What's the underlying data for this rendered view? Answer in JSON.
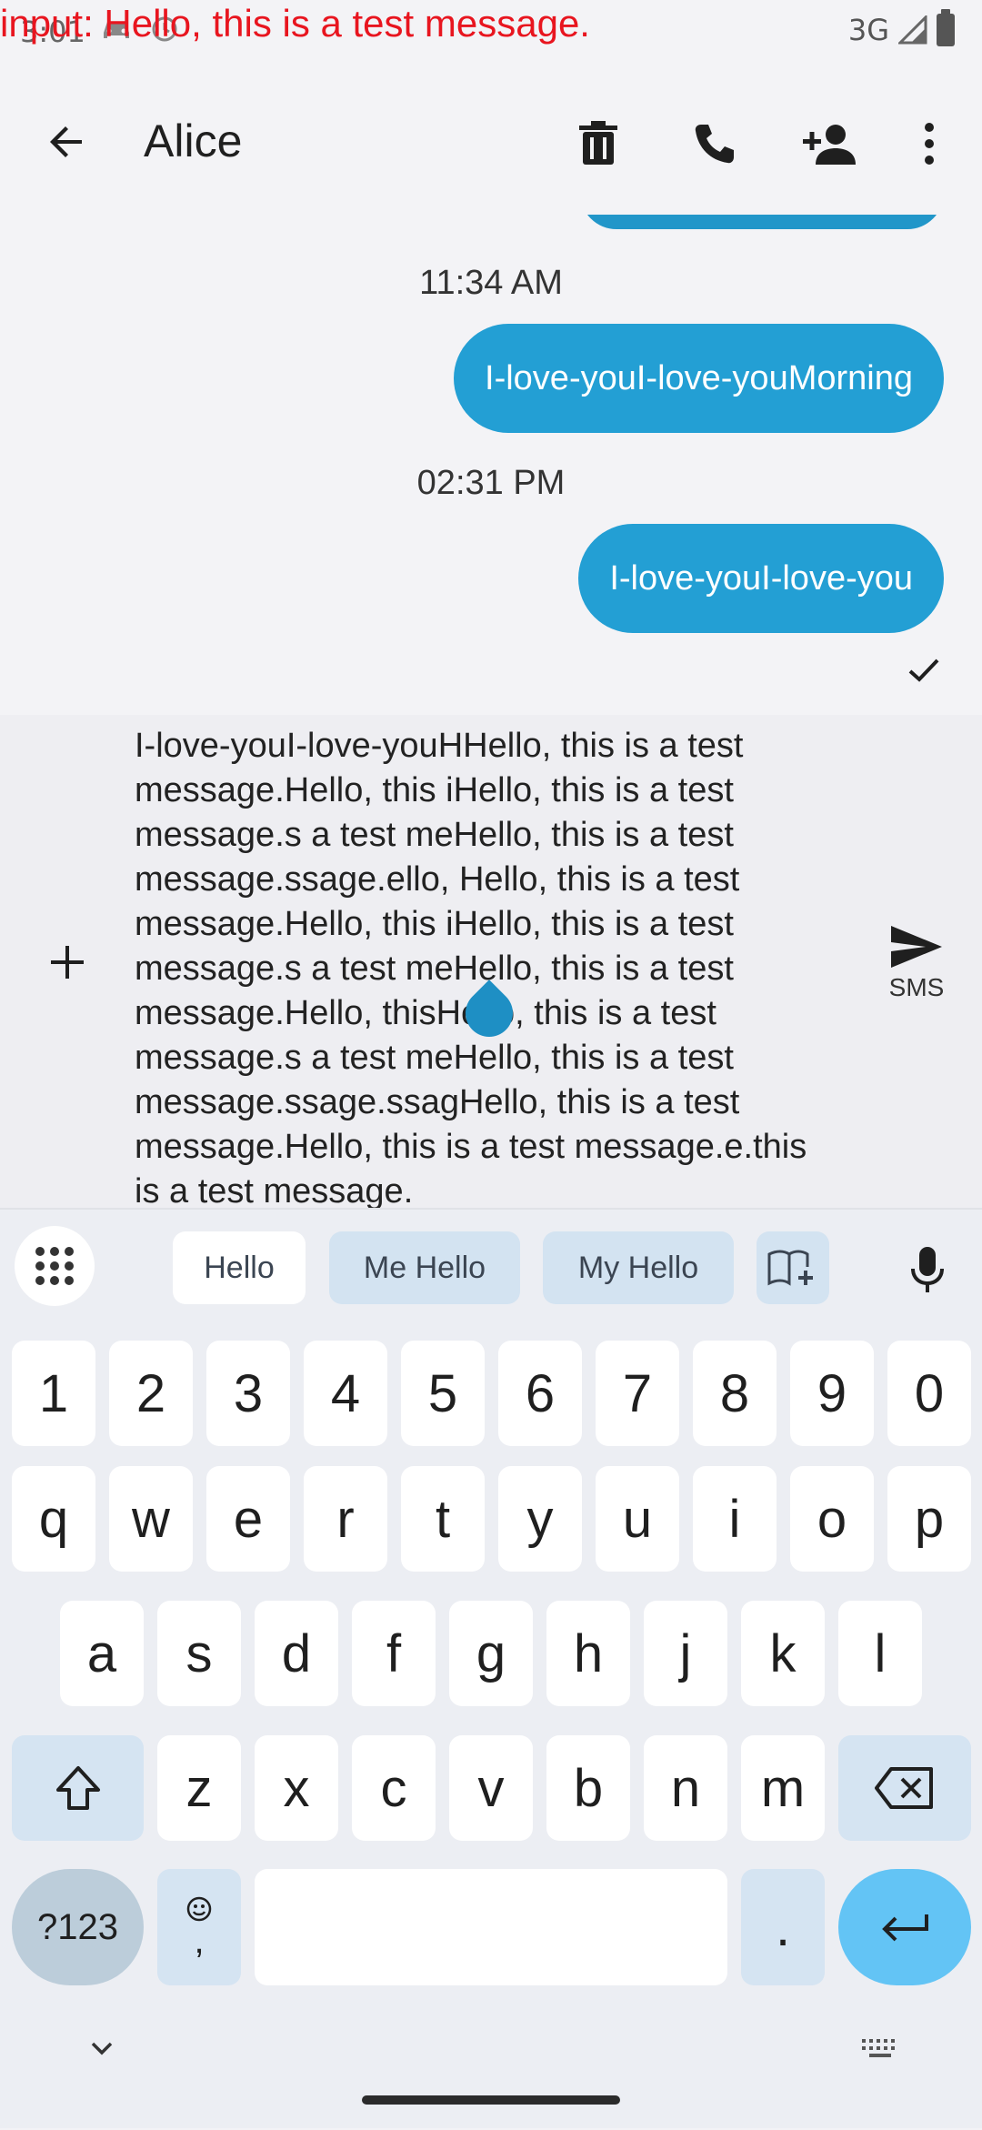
{
  "overlay": {
    "input_text": "input: Hello, this is a test message."
  },
  "status_bar": {
    "time": "3:01",
    "network": "3G"
  },
  "app_bar": {
    "title": "Alice"
  },
  "messages": [
    {
      "timestamp": "11:34 AM",
      "text": "I-love-youI-love-youMorning"
    },
    {
      "timestamp": "02:31 PM",
      "text": "I-love-youI-love-you"
    }
  ],
  "compose": {
    "text": "I-love-youI-love-youHHello, this is a test message.Hello, this iHello, this is a test message.s a test meHello, this is a test message.ssage.ello, Hello, this is a test message.Hello, this iHello, this is a test message.s a test meHello, this is a test message.Hello, thisHello, this is a test message.s a test meHello, this is a test message.ssage.ssagHello, this is a test message.Hello, this is a test message.e.this is a test message.",
    "send_label": "SMS"
  },
  "keyboard": {
    "suggestions": [
      "Hello",
      "Me Hello",
      "My Hello"
    ],
    "number_row": [
      "1",
      "2",
      "3",
      "4",
      "5",
      "6",
      "7",
      "8",
      "9",
      "0"
    ],
    "row1": [
      "q",
      "w",
      "e",
      "r",
      "t",
      "y",
      "u",
      "i",
      "o",
      "p"
    ],
    "row2": [
      "a",
      "s",
      "d",
      "f",
      "g",
      "h",
      "j",
      "k",
      "l"
    ],
    "row3": [
      "z",
      "x",
      "c",
      "v",
      "b",
      "n",
      "m"
    ],
    "symbols_label": "?123",
    "emoji_comma_label": ",",
    "period_label": "."
  },
  "colors": {
    "bubble": "#239fd4",
    "overlay_text": "#e8151f",
    "enter_key": "#63c4f5"
  }
}
